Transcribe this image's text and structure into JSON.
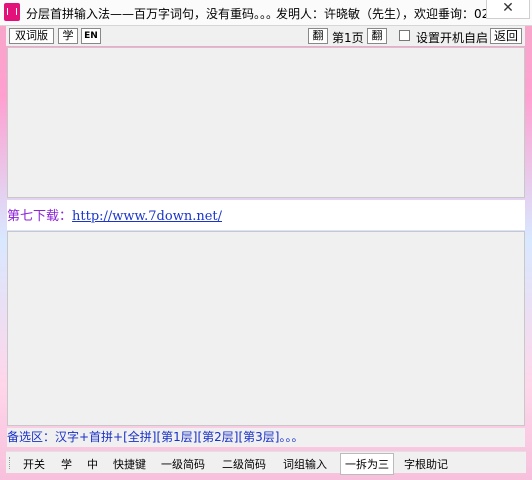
{
  "window": {
    "title": "分层首拼输入法——百万字词句，没有重码。。。",
    "title_author": "发明人：许晓敏（先生），欢迎垂询：02...",
    "close_glyph": "✕"
  },
  "toolbar": {
    "dict_label": "双词版",
    "learn_label": "学",
    "en_label": "EN",
    "prev_label": "翻",
    "page_label": "第1页",
    "next_label": "翻",
    "autostart_label": "设置开机自启",
    "back_label": "返回"
  },
  "ad": {
    "prefix": "第七下载：",
    "url": "http://www.7down.net/"
  },
  "candidates": {
    "text": "备选区：汉字+首拼+[全拼][第1层][第2层][第3层]。。。"
  },
  "statusbar": {
    "items": [
      "开关",
      "学",
      "中",
      "快捷键",
      "一级简码",
      "二级简码",
      "词组输入",
      "一拆为三",
      "字根助记"
    ]
  },
  "colors": {
    "accent": "#e2127a",
    "link": "#1a35c9",
    "prefix": "#8b22d6",
    "candidate": "#1a30c8"
  }
}
